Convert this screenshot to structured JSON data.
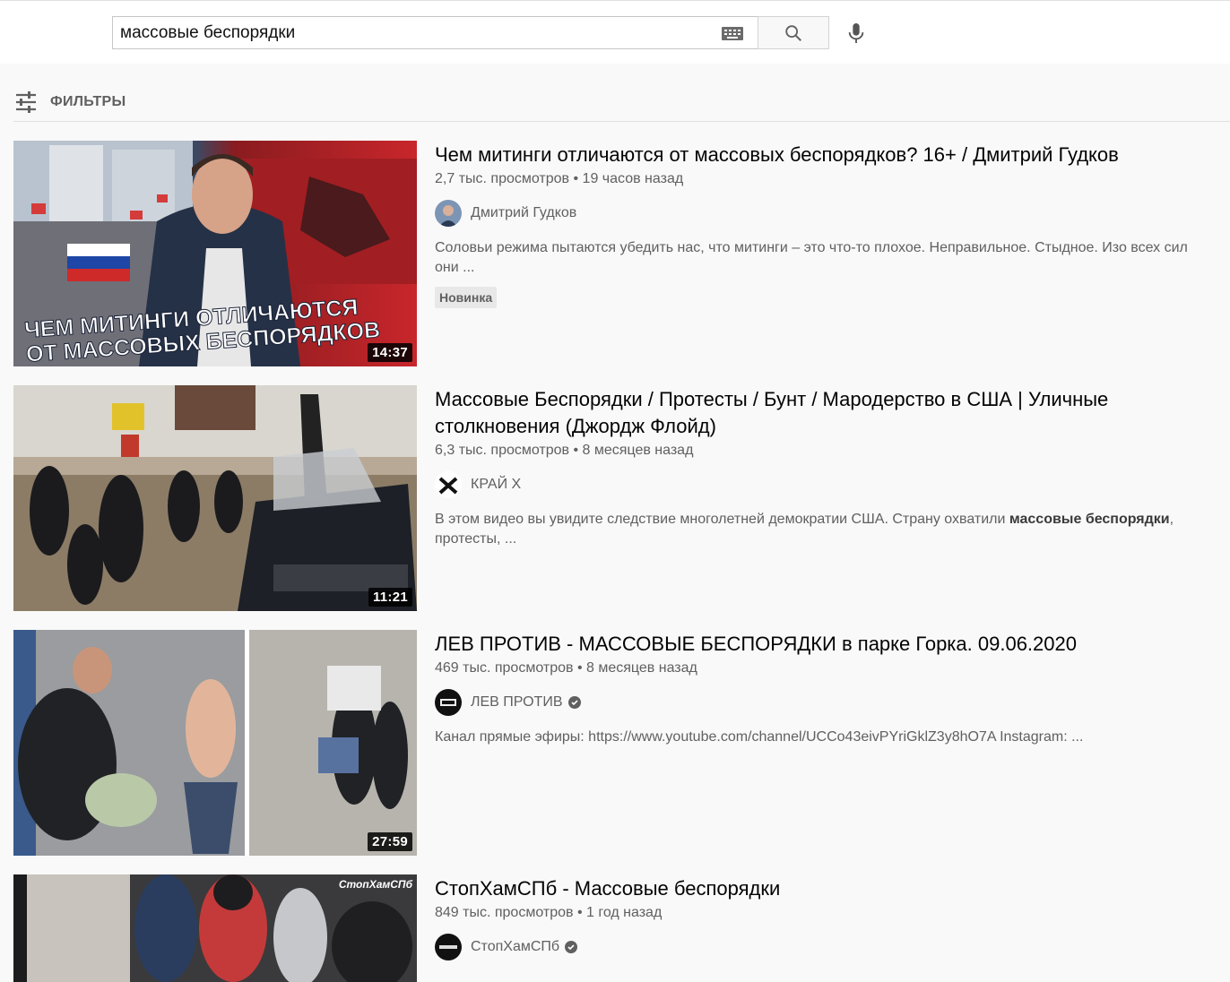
{
  "search": {
    "query": "массовые беспорядки"
  },
  "filters": {
    "label": "ФИЛЬТРЫ"
  },
  "results": [
    {
      "title": "Чем митинги отличаются от массовых беспорядков? 16+ / Дмитрий Гудков",
      "views": "2,7 тыс. просмотров",
      "age": "19 часов назад",
      "channel": "Дмитрий Гудков",
      "description": "Соловьи режима пытаются убедить нас, что митинги – это что-то плохое. Неправильное. Стыдное. Изо всех сил они ...",
      "badge": "Новинка",
      "duration": "14:37",
      "thumb_text_line1": "ЧЕМ МИТИНГИ ОТЛИЧАЮТСЯ",
      "thumb_text_line2": "ОТ МАССОВЫХ БЕСПОРЯДКОВ"
    },
    {
      "title": "Массовые Беспорядки / Протесты / Бунт / Мародерство в США | Уличные столкновения (Джордж Флойд)",
      "views": "6,3 тыс. просмотров",
      "age": "8 месяцев назад",
      "channel": "КРАЙ Х",
      "description_before": "В этом видео вы увидите следствие многолетней демократии США. Страну охватили ",
      "description_bold": "массовые беспорядки",
      "description_after": ", протесты, ...",
      "duration": "11:21"
    },
    {
      "title": "ЛЕВ ПРОТИВ - МАССОВЫЕ БЕСПОРЯДКИ в парке Горка. 09.06.2020",
      "views": "469 тыс. просмотров",
      "age": "8 месяцев назад",
      "channel": "ЛЕВ ПРОТИВ",
      "description": "Канал прямые эфиры: https://www.youtube.com/channel/UCCo43eivPYriGklZ3y8hO7A Instagram: ...",
      "duration": "27:59"
    },
    {
      "title": "СтопХамСПб - Массовые беспорядки",
      "views": "849 тыс. просмотров",
      "age": "1 год назад",
      "channel": "СтопХамСПб",
      "thumb_logo": "СтопХамСПб"
    }
  ],
  "colors": {
    "text_primary": "#030303",
    "text_secondary": "#606060",
    "background": "#f9f9f9"
  }
}
